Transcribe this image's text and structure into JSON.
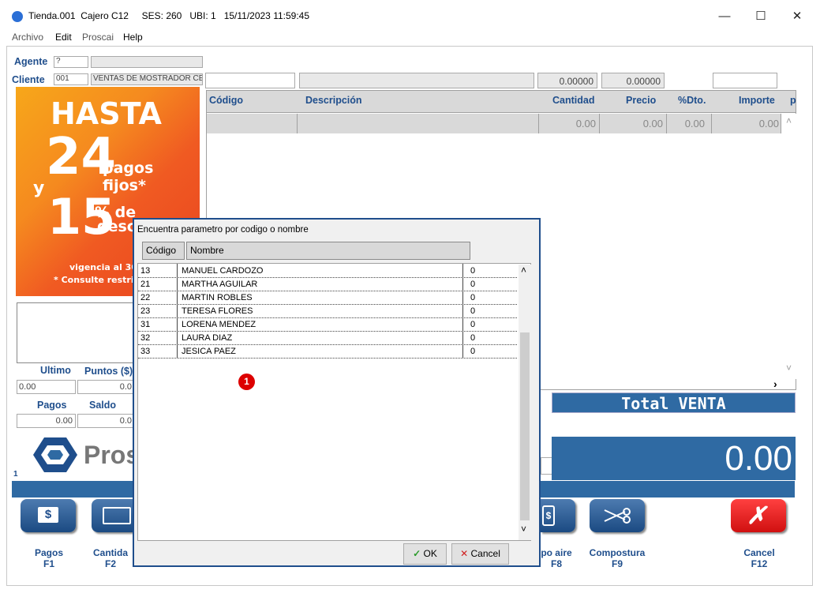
{
  "window": {
    "title": "Tienda.001  Cajero C12     SES: 260   UBI: 1   15/11/2023 11:59:45",
    "minimize": "—",
    "maximize": "☐",
    "close": "✕"
  },
  "menu": [
    "Archivo",
    "Edit",
    "Proscai",
    "Help"
  ],
  "header": {
    "agente_label": "Agente",
    "agente_value": "?",
    "cliente_label": "Cliente",
    "cliente_code": "001",
    "cliente_name": "VENTAS DE MOSTRADOR CEN",
    "value1": "0.00000",
    "value2": "0.00000"
  },
  "promo": {
    "line1": "HASTA",
    "line2": "24",
    "line3": "pagos fijos*",
    "line4": "y",
    "line5": "15",
    "line6": "% de",
    "line7": "descu",
    "line8": "vigencia al 30 n",
    "line9": "* Consulte restricc"
  },
  "grid": {
    "columns": [
      "Código",
      "Descripción",
      "Cantidad",
      "Precio",
      "%Dto.",
      "Importe",
      "p"
    ],
    "row": [
      "",
      "",
      "0.00",
      "0.00",
      "0.00",
      "0.00"
    ],
    "scroll_up": "˄",
    "scroll_down": "˅",
    "scroll_right": "›"
  },
  "left": {
    "ultimo_label": "Ultimo",
    "puntos_label": "Puntos ($)",
    "ultimo_value": "0.00",
    "puntos_value": "0.0",
    "pagos_label": "Pagos",
    "saldo_label": "Saldo",
    "pagos_value": "0.00",
    "saldo_value": "0.0",
    "logo_text": "Pros",
    "counter": "1"
  },
  "total": {
    "label": "Total VENTA",
    "value": "0.00"
  },
  "fbuttons": [
    {
      "label": "Pagos",
      "key": "F1",
      "icon": "cash-icon"
    },
    {
      "label": "Cantida",
      "key": "F2",
      "icon": "calculator-icon"
    },
    {
      "label": "po aire",
      "key": "F8",
      "icon": "phone-icon"
    },
    {
      "label": "Compostura",
      "key": "F9",
      "icon": "scissors-icon"
    },
    {
      "label": "Cancel",
      "key": "F12",
      "icon": "x-icon"
    }
  ],
  "dialog": {
    "title": "Encuentra parametro por codigo o nombre",
    "col_codigo": "Código",
    "col_nombre": "Nombre",
    "rows": [
      {
        "code": "13",
        "name": "MANUEL CARDOZO",
        "val": "0"
      },
      {
        "code": "21",
        "name": "MARTHA AGUILAR",
        "val": "0"
      },
      {
        "code": "22",
        "name": "MARTIN ROBLES",
        "val": "0"
      },
      {
        "code": "23",
        "name": "TERESA FLORES",
        "val": "0"
      },
      {
        "code": "31",
        "name": "LORENA MENDEZ",
        "val": "0"
      },
      {
        "code": "32",
        "name": "LAURA DIAZ",
        "val": "0"
      },
      {
        "code": "33",
        "name": "JESICA PAEZ",
        "val": "0"
      }
    ],
    "ok": "OK",
    "cancel": "Cancel",
    "scroll_up": "˄",
    "scroll_down": "˅"
  },
  "badge": "1"
}
